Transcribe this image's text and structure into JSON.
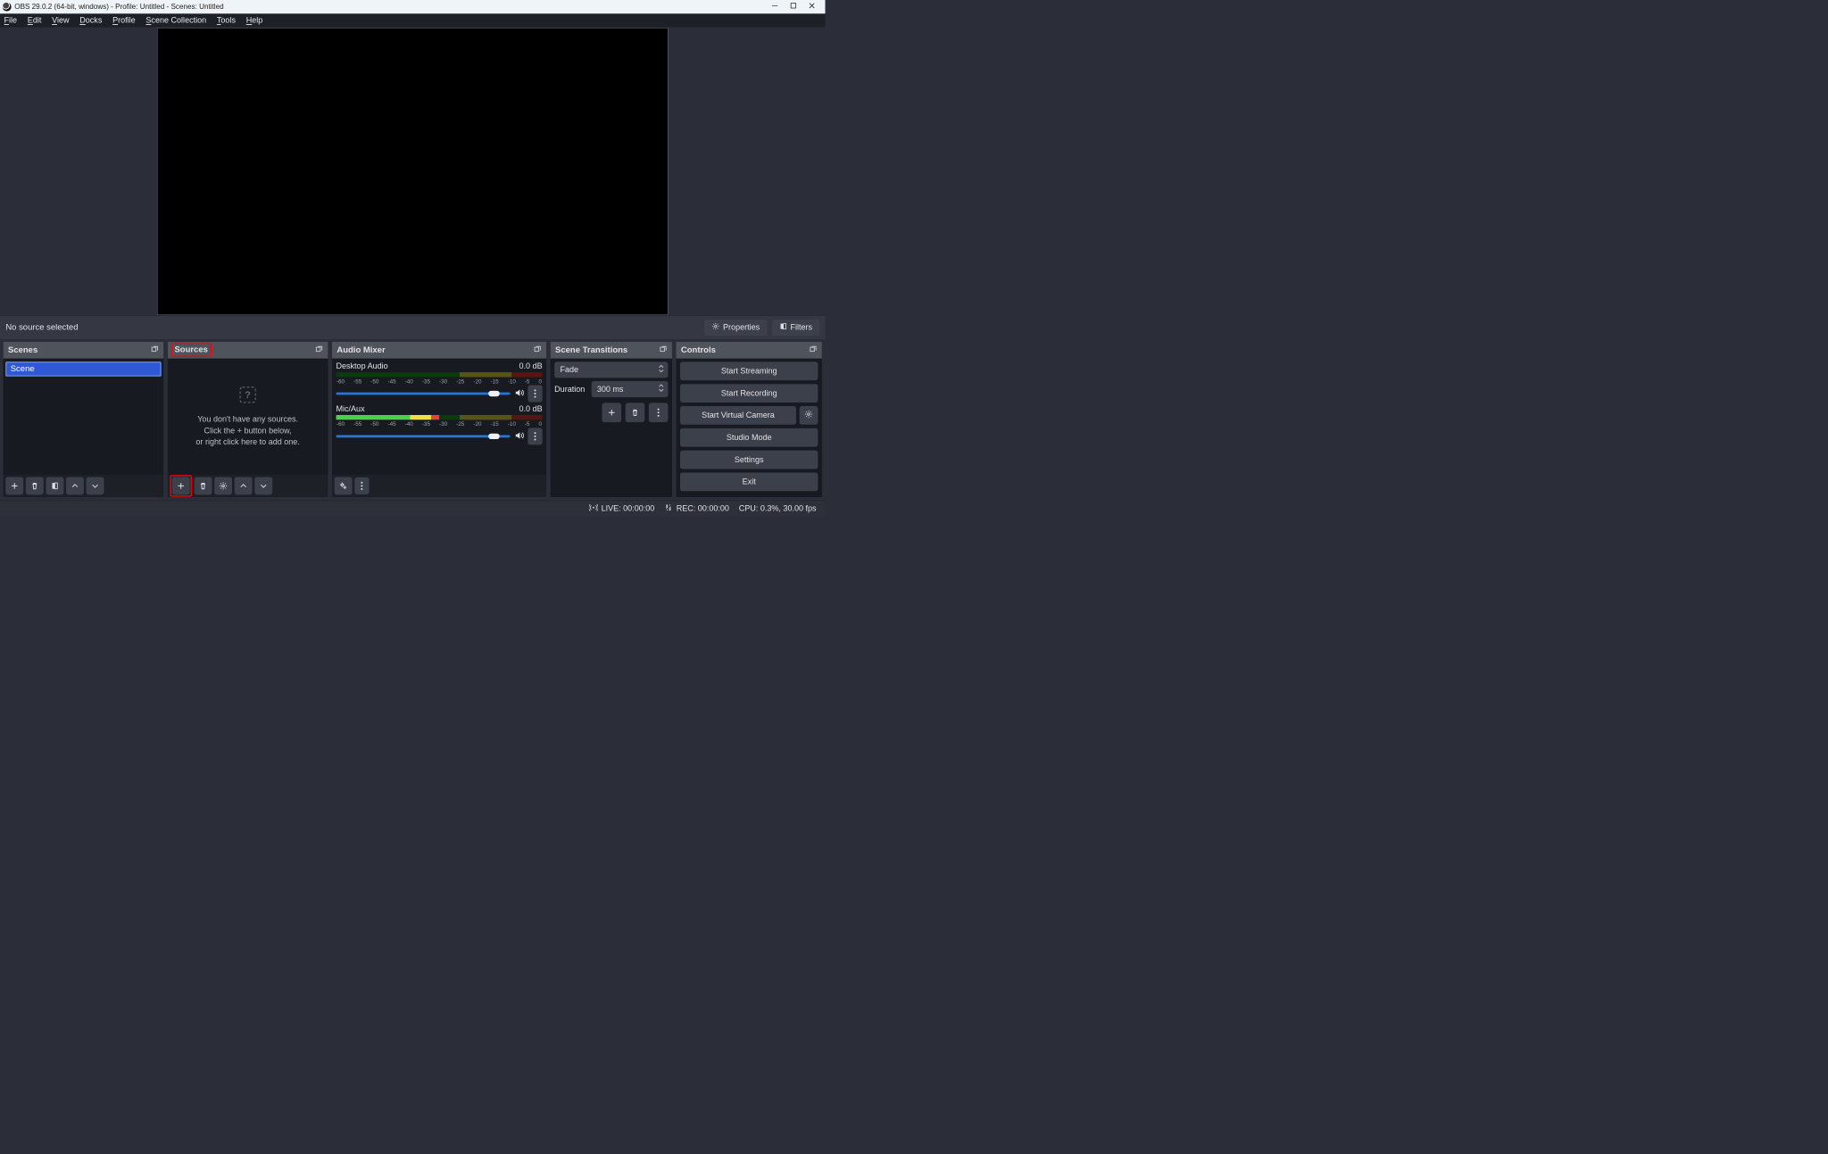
{
  "titlebar": {
    "title": "OBS 29.0.2 (64-bit, windows) - Profile: Untitled - Scenes: Untitled"
  },
  "menu": {
    "file": "File",
    "edit": "Edit",
    "view": "View",
    "docks": "Docks",
    "profile": "Profile",
    "scene_collection": "Scene Collection",
    "tools": "Tools",
    "help": "Help"
  },
  "under_preview": {
    "no_source": "No source selected",
    "properties": "Properties",
    "filters": "Filters"
  },
  "scenes": {
    "title": "Scenes",
    "items": [
      "Scene"
    ]
  },
  "sources": {
    "title": "Sources",
    "empty1": "You don't have any sources.",
    "empty2": "Click the + button below,",
    "empty3": "or right click here to add one."
  },
  "mixer": {
    "title": "Audio Mixer",
    "ticks": [
      "-60",
      "-55",
      "-50",
      "-45",
      "-40",
      "-35",
      "-30",
      "-25",
      "-20",
      "-15",
      "-10",
      "-5",
      "0"
    ],
    "channels": [
      {
        "name": "Desktop Audio",
        "db": "0.0 dB",
        "fill_pct": 0
      },
      {
        "name": "Mic/Aux",
        "db": "0.0 dB",
        "fill_pct": 50
      }
    ]
  },
  "transitions": {
    "title": "Scene Transitions",
    "selected": "Fade",
    "duration_label": "Duration",
    "duration_value": "300 ms"
  },
  "controls": {
    "title": "Controls",
    "buttons": {
      "start_streaming": "Start Streaming",
      "start_recording": "Start Recording",
      "start_virtual_camera": "Start Virtual Camera",
      "studio_mode": "Studio Mode",
      "settings": "Settings",
      "exit": "Exit"
    }
  },
  "statusbar": {
    "live": "LIVE: 00:00:00",
    "rec": "REC: 00:00:00",
    "cpu": "CPU: 0.3%, 30.00 fps"
  }
}
